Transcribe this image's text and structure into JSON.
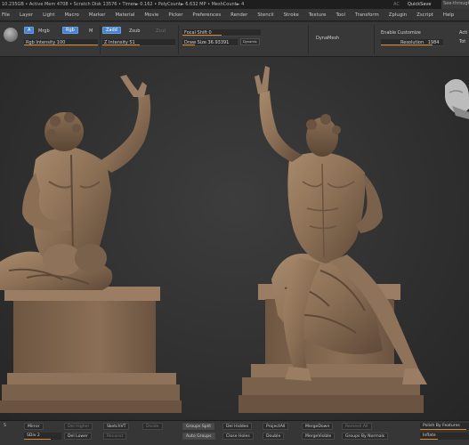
{
  "titlebar": {
    "text": "10.235GB • Active Mem 4708 • Scratch Disk 13576 • Timer► 0.162 • PolyCount► 6.632 MP • MeshCount► 4",
    "ac_label": "AC",
    "quicksave_label": "QuickSave",
    "see_through_label": "See-through"
  },
  "menu": {
    "items": [
      "File",
      "Layer",
      "Light",
      "Macro",
      "Marker",
      "Material",
      "Movie",
      "Picker",
      "Preferences",
      "Render",
      "Stencil",
      "Stroke",
      "Texture",
      "Tool",
      "Transform",
      "Zplugin",
      "Zscript",
      "Help"
    ]
  },
  "toolbar": {
    "a_label": "A",
    "mrgb_label": "Mrgb",
    "rgb_label": "Rgb",
    "m_label": "M",
    "zadd_label": "Zadd",
    "zsub_label": "Zsub",
    "zcut_label": "Zcut",
    "rgb_intensity_label": "Rgb Intensity 100",
    "z_intensity_label": "Z Intensity 51",
    "focal_shift_label": "Focal Shift 0",
    "draw_size_label": "Draw Size 36.93391",
    "dynamic_label": "Dynamic",
    "dynamesh_label": "DynaMesh",
    "enable_customize_label": "Enable Customize",
    "resolution_label": "Resolution",
    "resolution_value": "1984",
    "active_label": "Acti",
    "total_label": "Tot"
  },
  "bottombar": {
    "sdiv_num": "5",
    "mirror_label": "Mirror",
    "sdiv_label": "SDiv 2",
    "del_higher_label": "Del Higher",
    "del_lower_label": "Del Lower",
    "sketch_label": "SketchVT",
    "reconst_label": "Reconst",
    "divide_label": "Divide",
    "groups_split_label": "Groups Split",
    "auto_groups_label": "Auto Groups",
    "del_hidden_label": "Del Hidden",
    "close_holes_label": "Close Holes",
    "project_all_label": "ProjectAll",
    "double_label": "Double",
    "merge_down_label": "MergeDown",
    "merge_visible_label": "MergeVisible",
    "remesh_all_label": "Remesh All",
    "groups_by_normals_label": "Groups By Normals",
    "polish_label": "Polish By Features",
    "inflate_label": "Inflate"
  },
  "colors": {
    "accent_blue": "#4a83c9",
    "slider_orange": "#d98a2a",
    "clay": "#8b6f55"
  }
}
